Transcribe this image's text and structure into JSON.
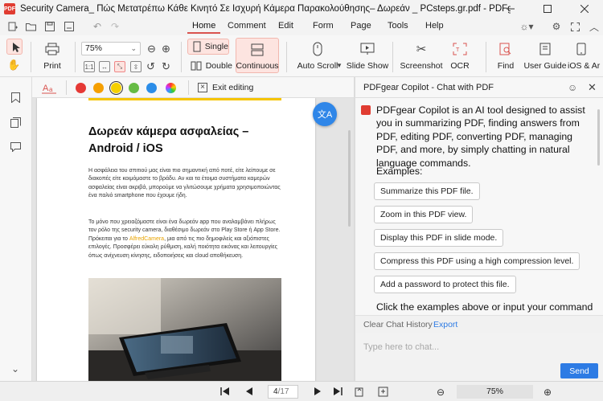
{
  "window": {
    "title": "Security Camera_ Πώς Μετατρέπω Κάθε Κινητό Σε Ισχυρή Κάμερα Παρακολούθησης– Δωρεάν _ PCsteps.gr.pdf - PDFgear",
    "app_logo_text": "PDF",
    "minimize_icon": "minimize-icon",
    "maximize_icon": "maximize-icon",
    "close_icon": "close-icon"
  },
  "menu": {
    "tabs": [
      "Home",
      "Comment",
      "Edit",
      "Form",
      "Page",
      "Tools",
      "Help"
    ],
    "active_tab": "Home"
  },
  "toolbar": {
    "print_label": "Print",
    "zoom_value": "75%",
    "single_label": "Single",
    "double_label": "Double",
    "continuous_label": "Continuous",
    "auto_scroll_label": "Auto Scroll",
    "slide_show_label": "Slide Show",
    "screenshot_label": "Screenshot",
    "ocr_label": "OCR",
    "find_label": "Find",
    "user_guide_label": "User Guide",
    "ios_label": "iOS & Ar"
  },
  "annotation_bar": {
    "colors": [
      "#e53935",
      "#f59f00",
      "#f5d000",
      "#66bb44",
      "#2b8de8"
    ],
    "exit_label": "Exit editing"
  },
  "document": {
    "heading": "Δωρεάν κάμερα ασφαλείας – Android / iOS",
    "para1": "Η ασφάλεια του σπιτιού μας είναι πιο σημαντική από ποτέ, είτε λείπουμε σε διακοπές είτε κοιμόμαστε το βράδυ. Αν και τα έτοιμα συστήματα καμερών ασφαλείας είναι ακριβά, μπορούμε να γλιτώσουμε χρήματα χρησιμοποιώντας ένα παλιό smartphone που έχουμε ήδη.",
    "para2_a": "Το μόνο που χρειαζόμαστε είναι ένα δωρεάν app που αναλαμβάνει πλήρως τον ρόλο της security camera, διαθέσιμο δωρεάν στο Play Store ή App Store. Πρόκειται για το ",
    "para2_link": "AlfredCamera",
    "para2_b": ", μια από τις πιο δημοφιλείς και αξιόπιστες επιλογές. Προσφέρει εύκολη ρύθμιση, καλή ποιότητα εικόνας και λειτουργίες όπως ανίχνευση κίνησης, ειδοποιήσεις και cloud αποθήκευση.",
    "translate_icon_text": "文A"
  },
  "copilot": {
    "title": "PDFgear Copilot - Chat with PDF",
    "intro": "PDFgear Copilot is an AI tool designed to assist you in summarizing PDF, finding answers from PDF, editing PDF, converting PDF, managing PDF, and more, by simply chatting in natural language commands.",
    "examples_title": "Examples:",
    "examples": [
      "Summarize this PDF file.",
      "Zoom in this PDF view.",
      "Display this PDF in slide mode.",
      "Compress this PDF using a high compression level.",
      "Add a password to protect this file."
    ],
    "outro": "Click the examples above or input your command to start the chat.",
    "clear_label": "Clear Chat History",
    "export_label": "Export",
    "input_placeholder": "Type here to chat...",
    "send_label": "Send"
  },
  "statusbar": {
    "page_value": "4",
    "page_total": "/17",
    "zoom_value": "75%"
  }
}
